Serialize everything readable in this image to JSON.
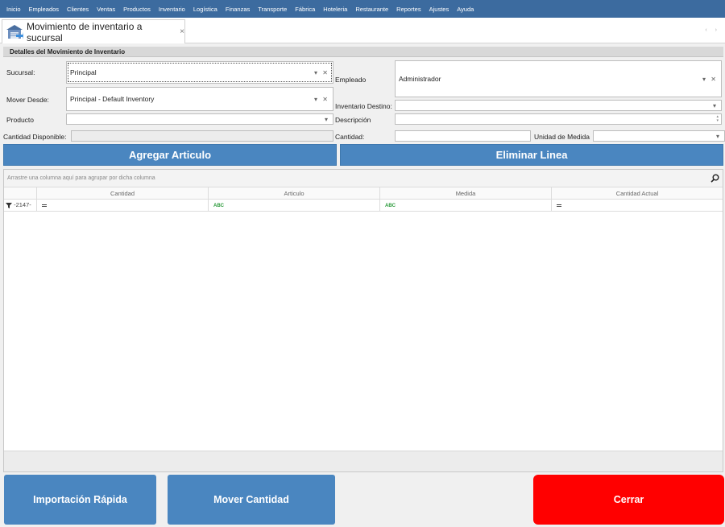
{
  "menu": [
    "Inicio",
    "Empleados",
    "Clientes",
    "Ventas",
    "Productos",
    "Inventario",
    "Logística",
    "Finanzas",
    "Transporte",
    "Fábrica",
    "Hoteleria",
    "Restaurante",
    "Reportes",
    "Ajustes",
    "Ayuda"
  ],
  "tab": {
    "title": "Movimiento de inventario a sucursal",
    "close": "×"
  },
  "tab_nav": "‹ ›",
  "section": {
    "title": "Detalles del Movimiento de Inventario"
  },
  "form": {
    "sucursal_label": "Sucursal:",
    "sucursal_value": "Principal",
    "mover_desde_label": "Mover Desde:",
    "mover_desde_value": "Principal - Default Inventory",
    "producto_label": "Producto",
    "producto_value": "",
    "cantidad_disponible_label": "Cantidad Disponible:",
    "cantidad_disponible_value": "",
    "empleado_label": "Empleado",
    "empleado_value": "Administrador",
    "inventario_destino_label": "Inventario Destino:",
    "inventario_destino_value": "",
    "descripcion_label": "Descripción",
    "descripcion_value": "",
    "cantidad_label": "Cantidad:",
    "cantidad_value": "",
    "unidad_label": "Unidad de Medida",
    "unidad_value": ""
  },
  "actions": {
    "agregar": "Agregar Articulo",
    "eliminar": "Eliminar Linea"
  },
  "grid": {
    "group_hint": "Arrastre una columna aquí para agrupar por dicha columna",
    "columns": [
      "Cantidad",
      "Articulo",
      "Medida",
      "Cantidad Actual"
    ],
    "filter_row_first": "-2147-",
    "filter_abc": "ABC"
  },
  "bottom": {
    "importacion": "Importación Rápida",
    "mover": "Mover Cantidad",
    "cerrar": "Cerrar"
  },
  "colors": {
    "menubar": "#3c6b9f",
    "button_blue": "#4a86c0",
    "close_red": "#ff0000"
  }
}
